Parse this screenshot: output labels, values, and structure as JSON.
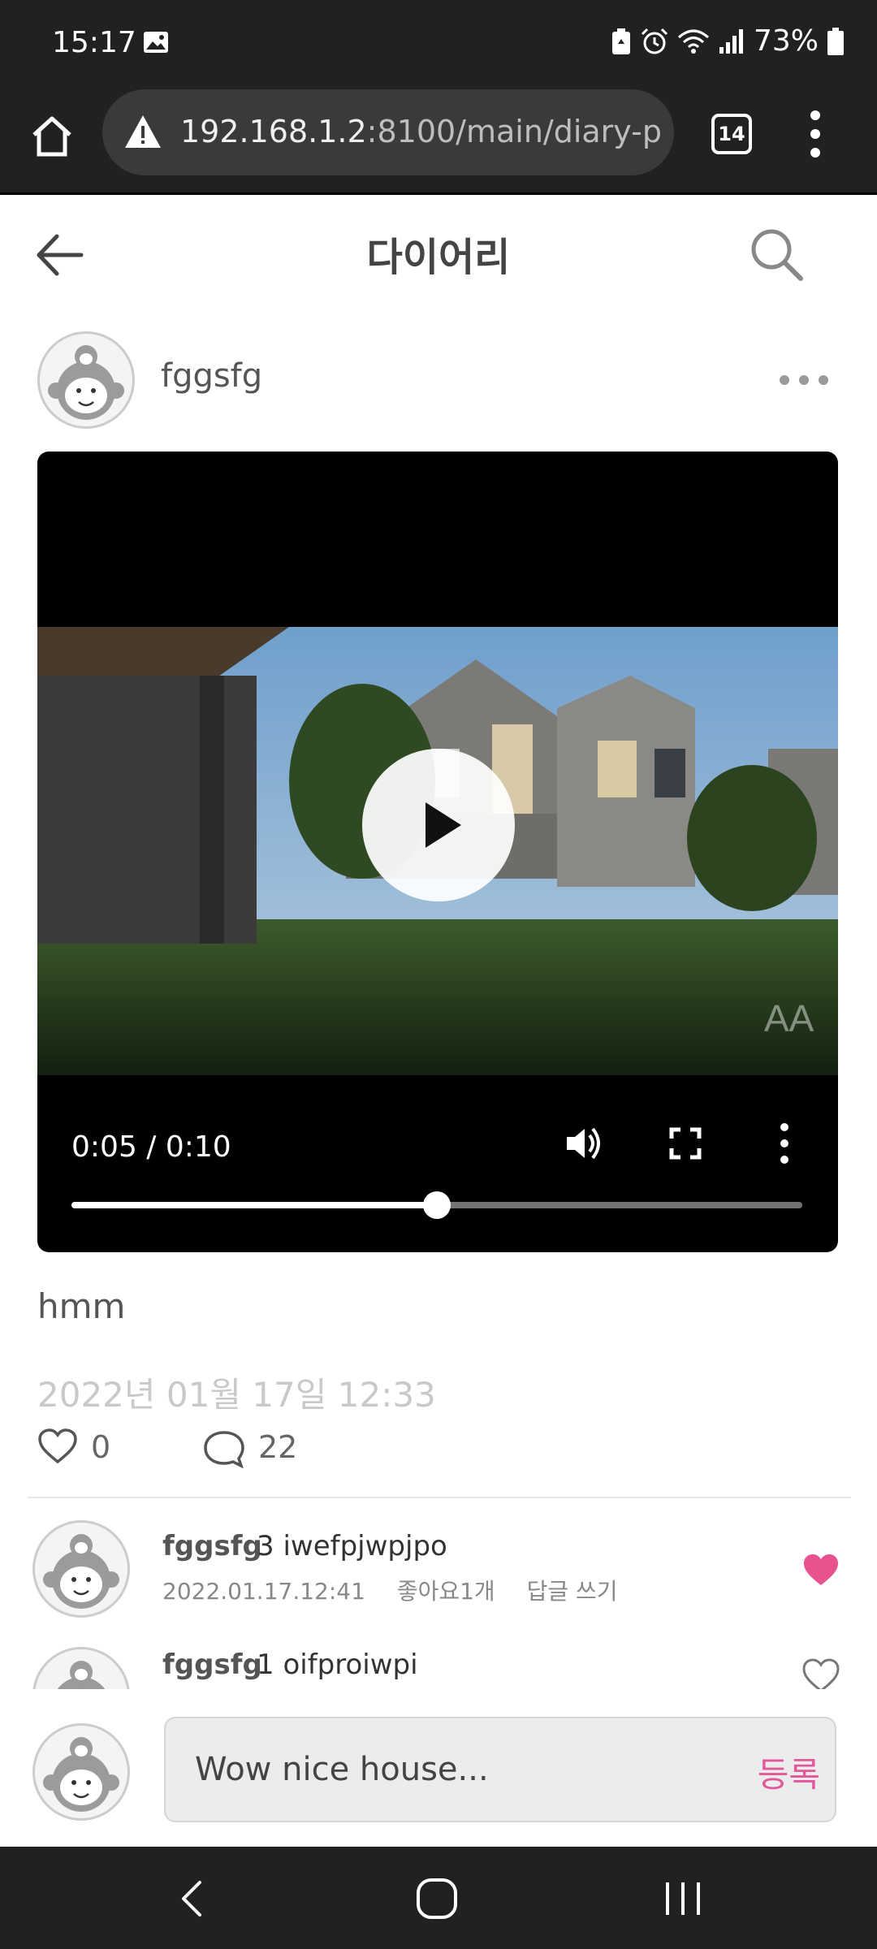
{
  "status_bar": {
    "time": "15:17",
    "battery": "73%"
  },
  "browser": {
    "url_host": "192.168.1.2",
    "url_path": ":8100/main/diary-p",
    "tab_count": "14"
  },
  "header": {
    "title": "다이어리"
  },
  "post": {
    "author": "fggsfg",
    "text": "hmm",
    "date": "2022년 01월 17일 12:33",
    "likes": "0",
    "comments": "22"
  },
  "video": {
    "time_display": "0:05 / 0:10",
    "progress": 0.5
  },
  "comments": [
    {
      "author": "fggsfg",
      "text": "3 iwefpjwpjpo",
      "date": "2022.01.17.12:41",
      "likes_label": "좋아요1개",
      "reply_label": "답글 쓰기",
      "liked": true
    },
    {
      "author": "fggsfg",
      "text": "1 oifproiwpi",
      "date": "",
      "likes_label": "",
      "reply_label": "",
      "liked": false
    }
  ],
  "comment_input": {
    "value": "Wow nice house...",
    "submit_label": "등록"
  },
  "colors": {
    "accent_pink": "#e2589a",
    "chrome": "#212121"
  }
}
